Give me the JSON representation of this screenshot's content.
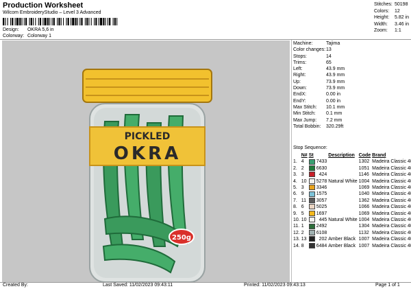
{
  "header": {
    "title": "Production Worksheet",
    "subtitle": "Wilcom EmbroideryStudio – Level 3 Advanced",
    "design_label": "Design:",
    "design_value": "OKRA 5,6 in",
    "colorway_label": "Colorway:",
    "colorway_value": "Colorway 1"
  },
  "stats": [
    {
      "label": "Stitches:",
      "value": "50198"
    },
    {
      "label": "Colors:",
      "value": "12"
    },
    {
      "label": "Height:",
      "value": "5.82 in"
    },
    {
      "label": "Width:",
      "value": "3.46 in"
    },
    {
      "label": "Zoom:",
      "value": "1:1"
    }
  ],
  "machine": [
    {
      "label": "Machine:",
      "value": "Tajima"
    },
    {
      "label": "Color changes:",
      "value": "13"
    },
    {
      "label": "Stops:",
      "value": "14"
    },
    {
      "label": "Trims:",
      "value": "65"
    },
    {
      "label": "Left:",
      "value": "43.9 mm"
    },
    {
      "label": "Right:",
      "value": "43.9 mm"
    },
    {
      "label": "Up:",
      "value": "73.9 mm"
    },
    {
      "label": "Down:",
      "value": "73.9 mm"
    },
    {
      "label": "EndX:",
      "value": "0.00 in"
    },
    {
      "label": "EndY:",
      "value": "0.00 in"
    },
    {
      "label": "Max Stitch:",
      "value": "10.1 mm"
    },
    {
      "label": "Min Stitch:",
      "value": "0.1 mm"
    },
    {
      "label": "Max Jump:",
      "value": "7.2 mm"
    },
    {
      "label": "Total Bobbin:",
      "value": "320.29ft"
    }
  ],
  "sequence": {
    "title": "Stop Sequence:",
    "headers": {
      "n": "N#",
      "st": "St",
      "desc": "Description",
      "code": "Code",
      "brand": "Brand"
    },
    "rows": [
      {
        "num": "1.",
        "n": "4",
        "color": "#3aa072",
        "st": "7433",
        "desc": "",
        "code": "1302",
        "brand": "Madeira Classic 40"
      },
      {
        "num": "2.",
        "n": "2",
        "color": "#1f7a3a",
        "st": "6630",
        "desc": "",
        "code": "1051",
        "brand": "Madeira Classic 40"
      },
      {
        "num": "3.",
        "n": "3",
        "color": "#c8202a",
        "st": "424",
        "desc": "",
        "code": "1146",
        "brand": "Madeira Classic 40"
      },
      {
        "num": "4.",
        "n": "10",
        "color": "#f2f2ee",
        "st": "5278",
        "desc": "Natural White",
        "code": "1004",
        "brand": "Madeira Classic 40"
      },
      {
        "num": "5.",
        "n": "3",
        "color": "#e8a21c",
        "st": "3346",
        "desc": "",
        "code": "1069",
        "brand": "Madeira Classic 40"
      },
      {
        "num": "6.",
        "n": "9",
        "color": "#7cc2d8",
        "st": "1575",
        "desc": "",
        "code": "1040",
        "brand": "Madeira Classic 40"
      },
      {
        "num": "7.",
        "n": "11",
        "color": "#5a5a5a",
        "st": "3057",
        "desc": "",
        "code": "1362",
        "brand": "Madeira Classic 40"
      },
      {
        "num": "8.",
        "n": "6",
        "color": "#e9d4c2",
        "st": "5025",
        "desc": "",
        "code": "1066",
        "brand": "Madeira Classic 40"
      },
      {
        "num": "9.",
        "n": "5",
        "color": "#f5b81c",
        "st": "1697",
        "desc": "",
        "code": "1069",
        "brand": "Madeira Classic 40"
      },
      {
        "num": "10.",
        "n": "10",
        "color": "#f2f2ee",
        "st": "445",
        "desc": "Natural White",
        "code": "1004",
        "brand": "Madeira Classic 40"
      },
      {
        "num": "11.",
        "n": "1",
        "color": "#2d6e3a",
        "st": "2492",
        "desc": "",
        "code": "1304",
        "brand": "Madeira Classic 40"
      },
      {
        "num": "12.",
        "n": "2",
        "color": "#9fb0b0",
        "st": "6108",
        "desc": "",
        "code": "1132",
        "brand": "Madeira Classic 40"
      },
      {
        "num": "13.",
        "n": "13",
        "color": "#222222",
        "st": "202",
        "desc": "Amber Black",
        "code": "1007",
        "brand": "Madeira Classic 40"
      },
      {
        "num": "14.",
        "n": "8",
        "color": "#333333",
        "st": "6484",
        "desc": "Amber Black",
        "code": "1007",
        "brand": "Madeira Classic 40"
      }
    ]
  },
  "artwork": {
    "label_top": "PICKLED",
    "label_main": "OKRA",
    "badge": "250g"
  },
  "footer": {
    "created_by": "Created By:",
    "last_saved": "Last Saved: 11/02/2023 09:43:11",
    "printed": "Printed: 11/02/2023 09:43:13",
    "page": "Page 1 of 1"
  }
}
